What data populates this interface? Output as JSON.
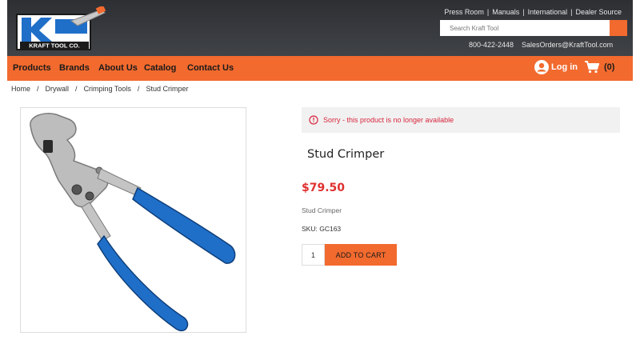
{
  "header": {
    "logo_text": "KRAFT TOOL CO.",
    "top_links": [
      "Press Room",
      "Manuals",
      "International",
      "Dealer Source"
    ],
    "search_placeholder": "Search Kraft Tool",
    "phone": "800-422-2448",
    "email": "SalesOrders@KraftTool.com"
  },
  "nav": {
    "items": [
      "Products",
      "Brands",
      "About Us",
      "Catalog",
      "Contact Us"
    ],
    "login_label": "Log in",
    "cart_count": "(0)"
  },
  "breadcrumb": [
    "Home",
    "Drywall",
    "Crimping Tools",
    "Stud Crimper"
  ],
  "product": {
    "alert": "Sorry - this product is no longer available",
    "title": "Stud Crimper",
    "price": "$79.50",
    "subname": "Stud Crimper",
    "sku_label": "SKU:",
    "sku": "GC163",
    "quantity": "1",
    "add_to_cart": "ADD TO CART"
  },
  "colors": {
    "accent": "#f26a2e",
    "header_dark": "#35373b",
    "alert_text": "#d7263d",
    "price": "#e03131",
    "logo_blue": "#1f6fc9"
  },
  "icons": [
    "user-icon",
    "cart-icon",
    "alert-circle-icon"
  ]
}
